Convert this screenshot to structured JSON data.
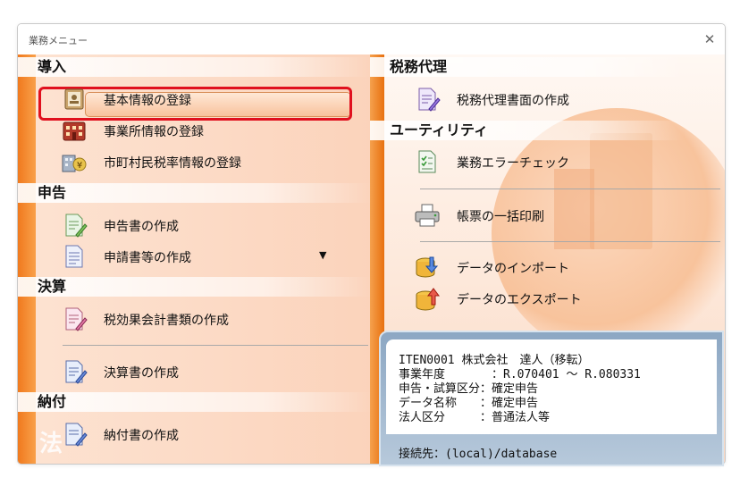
{
  "window": {
    "title": "業務メニュー"
  },
  "sections": {
    "intro": "導入",
    "declare": "申告",
    "settle": "決算",
    "pay": "納付",
    "tax_agent": "税務代理",
    "utility": "ユーティリティ"
  },
  "items": {
    "basic_info": "基本情報の登録",
    "office_info": "事業所情報の登録",
    "municipal_tax": "市町村民税率情報の登録",
    "create_return": "申告書の作成",
    "application_forms": "申請書等の作成",
    "tax_effect": "税効果会計書類の作成",
    "financial_statements": "決算書の作成",
    "payment_slip": "納付書の作成",
    "tax_agent_doc": "税務代理書面の作成",
    "error_check": "業務エラーチェック",
    "batch_print": "帳票の一括印刷",
    "data_import": "データのインポート",
    "data_export": "データのエクスポート"
  },
  "dropdown_glyph": "▼",
  "info": {
    "line1": "ITEN0001 株式会社　達人（移転）",
    "line2": "事業年度　　　　：R.070401 ～ R.080331",
    "line3": "申告・試算区分：確定申告",
    "line4": "データ名称　　：確定申告",
    "line5": "法人区分　　　：普通法人等",
    "connection": "接続先：(local)/database"
  },
  "logo_text": "法",
  "icons": {
    "close": "close-icon",
    "basic_info": "address-book-icon",
    "office": "building-icon",
    "municipal": "yen-building-icon",
    "create_return": "document-pen-icon",
    "application": "document-icon",
    "tax_effect": "document-pen-icon",
    "financial": "document-pen-icon",
    "payment": "document-pen-icon",
    "tax_agent": "document-pen-icon",
    "error_check": "checklist-icon",
    "print": "printer-icon",
    "import": "database-import-icon",
    "export": "database-export-icon"
  },
  "colors": {
    "accent_orange": "#f07a1e",
    "highlight_red": "#e0101e",
    "info_border": "#8ca7c3"
  }
}
